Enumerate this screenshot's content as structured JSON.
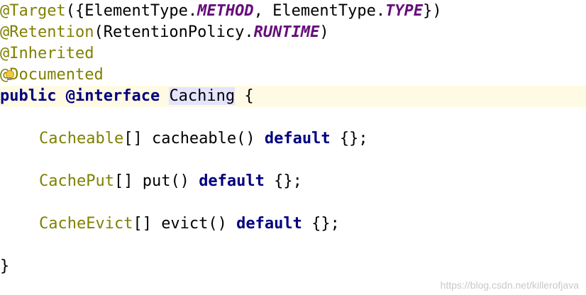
{
  "code": {
    "line1": {
      "target_anno": "@Target",
      "open": "({",
      "element_type_1": "ElementType.",
      "method_const": "METHOD",
      "comma": ", ",
      "element_type_2": "ElementType.",
      "type_const": "TYPE",
      "close": "})"
    },
    "line2": {
      "retention_anno": "@Retention",
      "open": "(",
      "policy": "RetentionPolicy.",
      "runtime_const": "RUNTIME",
      "close": ")"
    },
    "line3": {
      "inherited_anno": "@Inherited"
    },
    "line4": {
      "at_sign": "@",
      "documented_rest": "Documented"
    },
    "line5": {
      "public_kw": "public",
      "interface_kw": "@interface",
      "name": "Caching",
      "brace": "{"
    },
    "line6": {
      "type": "Cacheable",
      "rest": "[] cacheable() ",
      "default_kw": "default",
      "tail": " {};"
    },
    "line7": {
      "type": "CachePut",
      "rest": "[] put() ",
      "default_kw": "default",
      "tail": " {};"
    },
    "line8": {
      "type": "CacheEvict",
      "rest": "[] evict() ",
      "default_kw": "default",
      "tail": " {};"
    },
    "line9": {
      "close_brace": "}"
    }
  },
  "watermark": "https://blog.csdn.net/killerofjava",
  "colors": {
    "annotation": "#808000",
    "keyword": "#000080",
    "enum_constant": "#660e7a",
    "current_line": "#fffae3",
    "identifier_highlight": "#e4e4ff",
    "watermark": "#c8c8c8"
  },
  "icons": {
    "intention_bulb": "lightbulb-icon"
  }
}
